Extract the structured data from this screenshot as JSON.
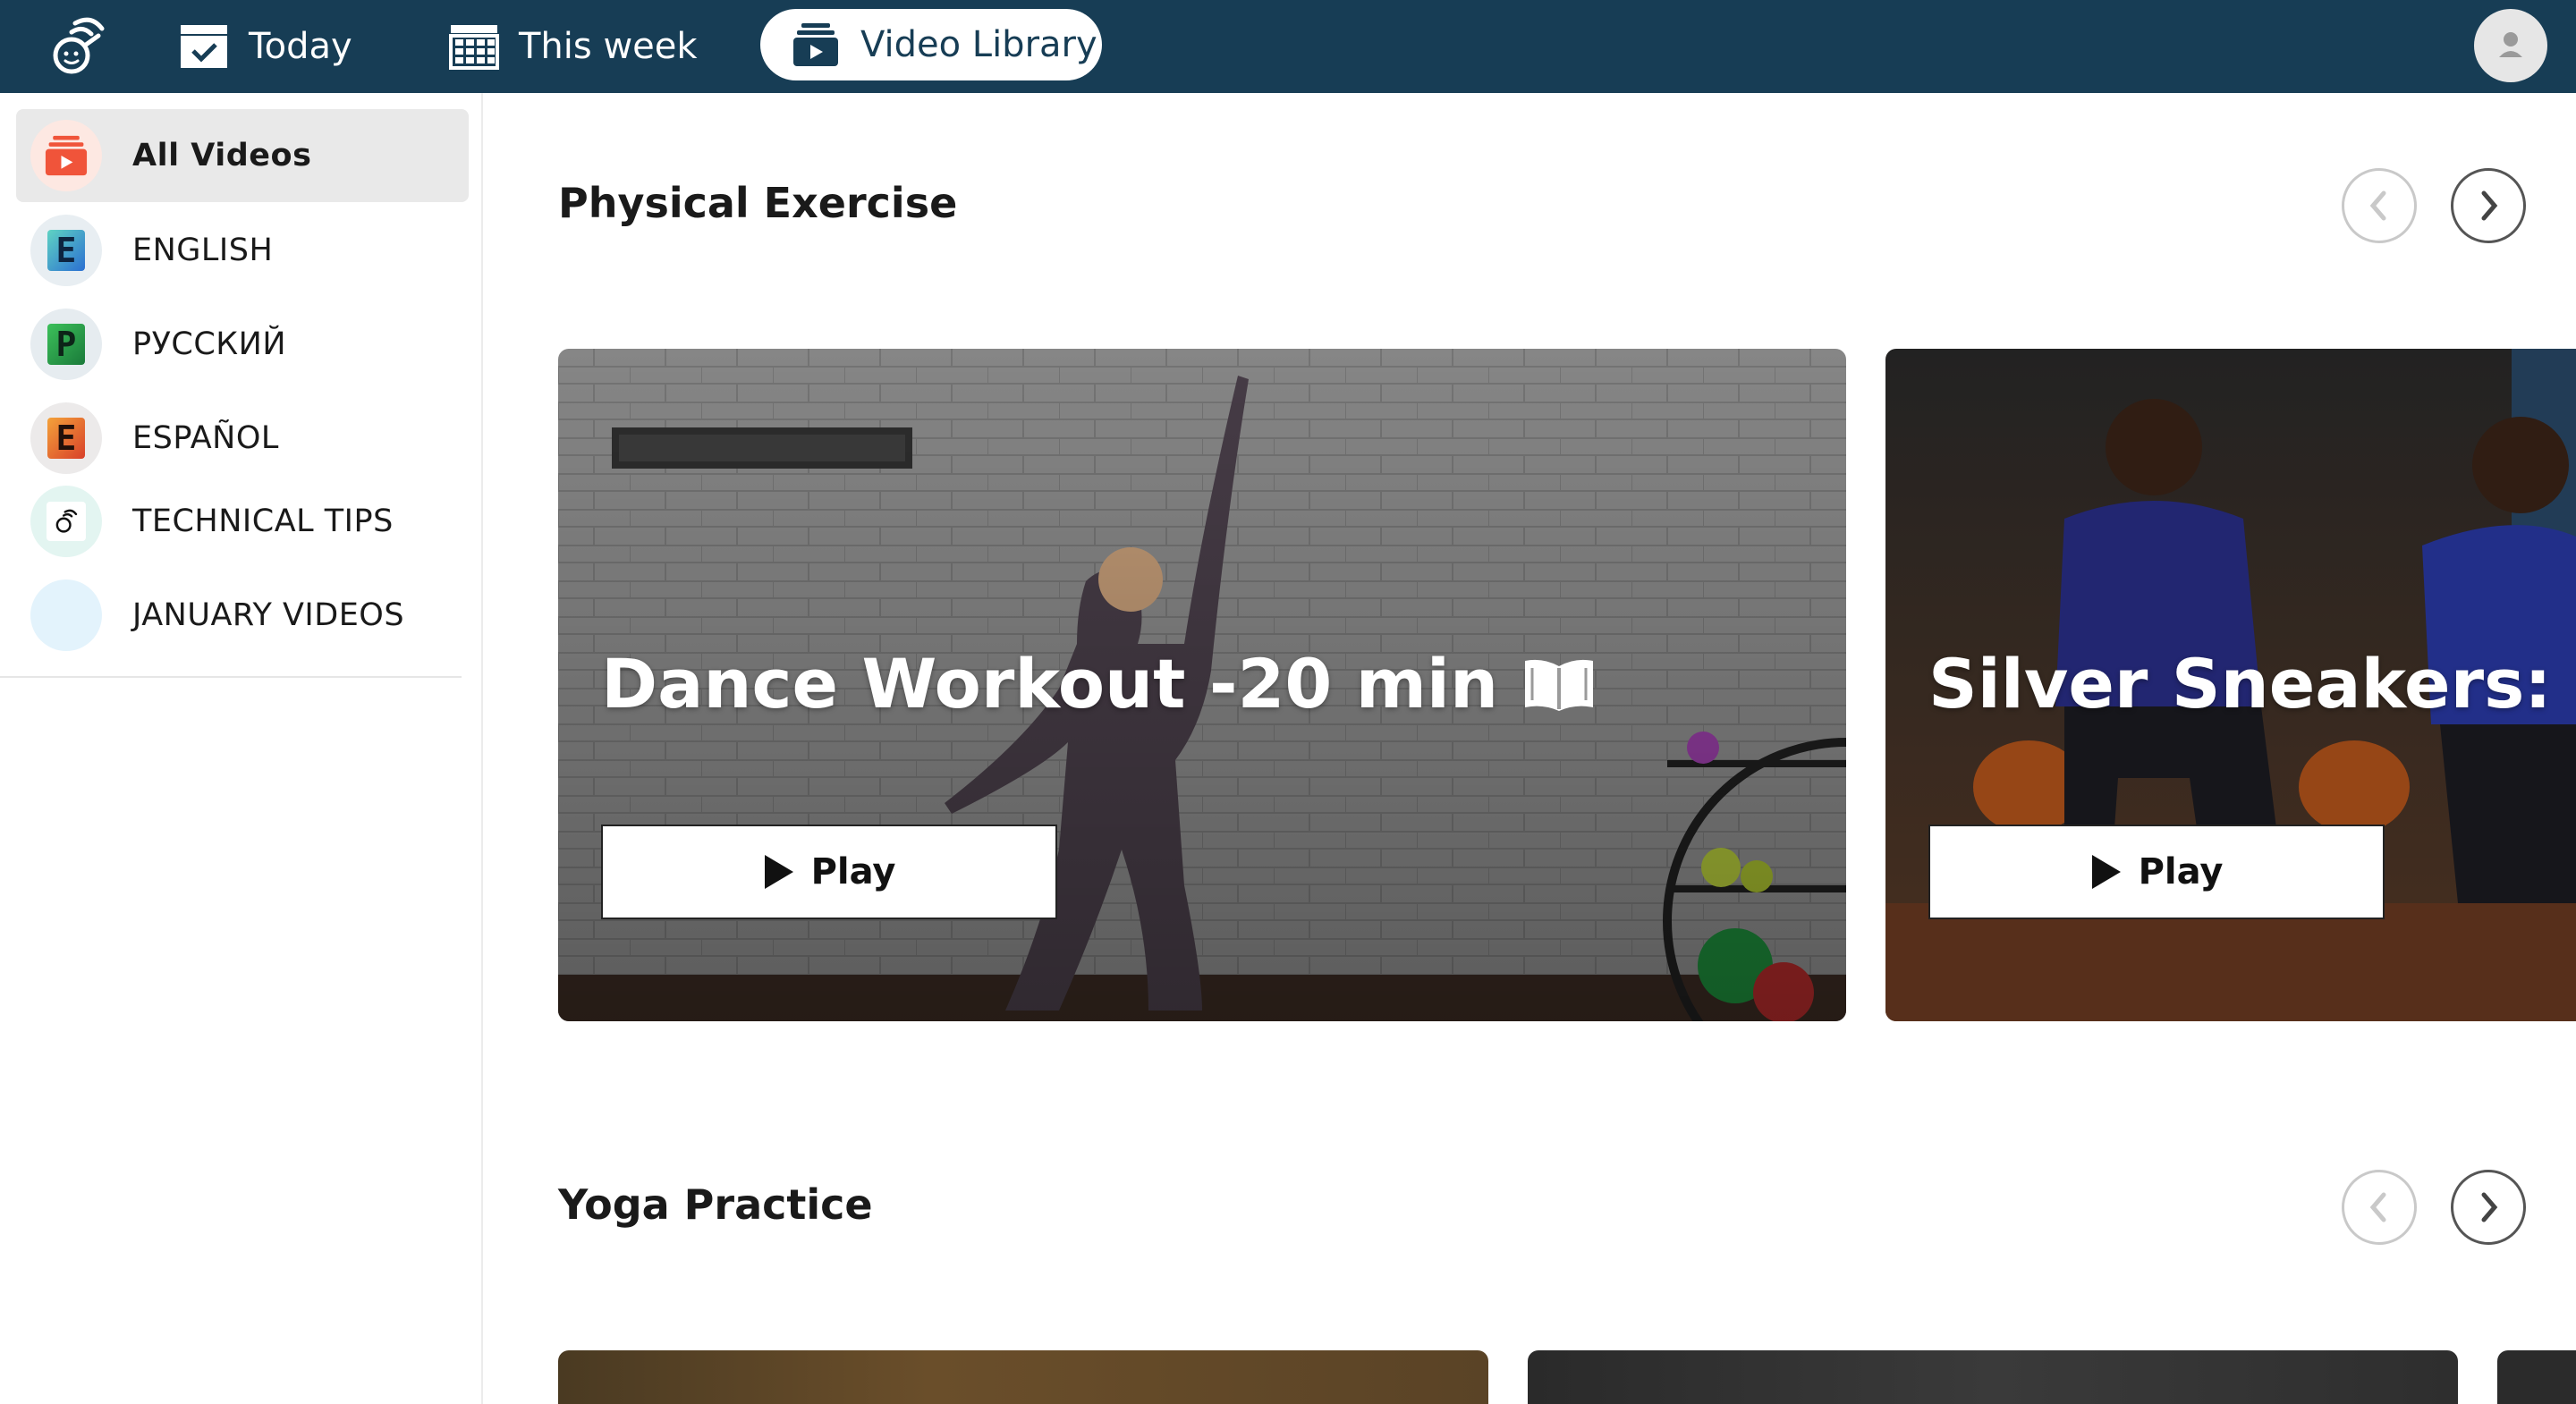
{
  "topnav": {
    "today_label": "Today",
    "week_label": "This week",
    "library_label": "Video Library"
  },
  "sidebar": {
    "items": [
      {
        "label": "All Videos",
        "active": true,
        "icon": "video-library-icon"
      },
      {
        "label": "ENGLISH",
        "badge_letter": "E",
        "icon": "letter-e-icon"
      },
      {
        "label": "РУССКИЙ",
        "badge_letter": "P",
        "icon": "letter-p-icon"
      },
      {
        "label": "ESPAÑOL",
        "badge_letter": "E",
        "icon": "letter-e-icon"
      },
      {
        "label": "TECHNICAL TIPS",
        "icon": "logo-icon"
      },
      {
        "label": "JANUARY VIDEOS",
        "icon": "blank-circle-icon"
      }
    ]
  },
  "sections": [
    {
      "title": "Physical Exercise",
      "cards": [
        {
          "title": "Dance Workout -20 min",
          "play_label": "Play",
          "title_icon": "book-icon"
        },
        {
          "title": "Silver Sneakers: M",
          "play_label": "Play"
        }
      ]
    },
    {
      "title": "Yoga Practice",
      "cards": []
    }
  ],
  "colors": {
    "topbar": "#173d55",
    "sidebar_active": "#e9e9e9"
  }
}
